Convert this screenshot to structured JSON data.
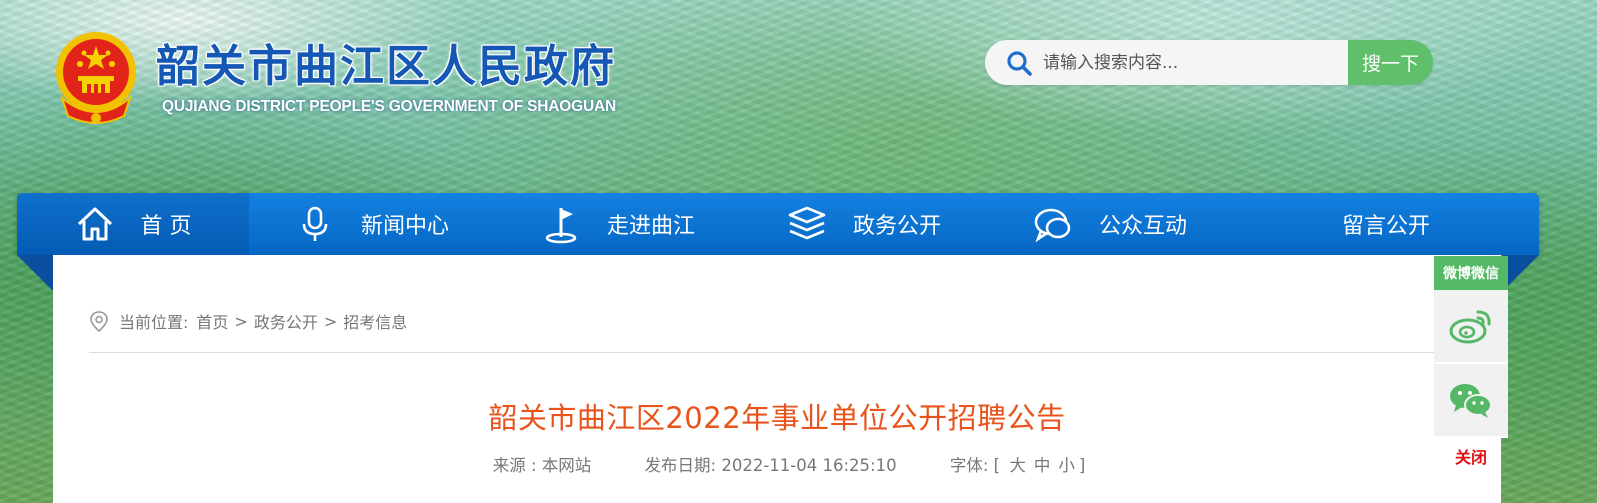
{
  "header": {
    "title": "韶关市曲江区人民政府",
    "subtitle": "QUJIANG DISTRICT PEOPLE'S GOVERNMENT OF SHAOGUAN"
  },
  "search": {
    "placeholder": "请输入搜索内容...",
    "button_label": "搜一下",
    "icon": "search-icon"
  },
  "nav": {
    "items": [
      {
        "label": "首 页",
        "icon": "home-icon"
      },
      {
        "label": "新闻中心",
        "icon": "microphone-icon"
      },
      {
        "label": "走进曲江",
        "icon": "flag-icon"
      },
      {
        "label": "政务公开",
        "icon": "stack-icon"
      },
      {
        "label": "公众互动",
        "icon": "chat-bubble-icon"
      },
      {
        "label": "留言公开",
        "icon": ""
      }
    ]
  },
  "breadcrumb": {
    "prefix": "当前位置:",
    "items": [
      "首页",
      "政务公开",
      "招考信息"
    ],
    "separator": ">"
  },
  "article": {
    "title": "韶关市曲江区2022年事业单位公开招聘公告",
    "source_label": "来源 : 本网站",
    "date_label": "发布日期:",
    "date_value": "2022-11-04 16:25:10",
    "font_label": "字体:",
    "font_open": "[",
    "font_large": "大",
    "font_medium": "中",
    "font_small": "小",
    "font_close": "]"
  },
  "side_widget": {
    "header": "微博微信",
    "items": [
      {
        "name": "weibo",
        "icon": "weibo-icon"
      },
      {
        "name": "wechat",
        "icon": "wechat-icon"
      }
    ],
    "close_label": "关闭"
  },
  "colors": {
    "nav_blue": "#0a6fd0",
    "title_orange": "#e8541c",
    "accent_green": "#5fbf6b",
    "close_red": "#e10f0f"
  }
}
